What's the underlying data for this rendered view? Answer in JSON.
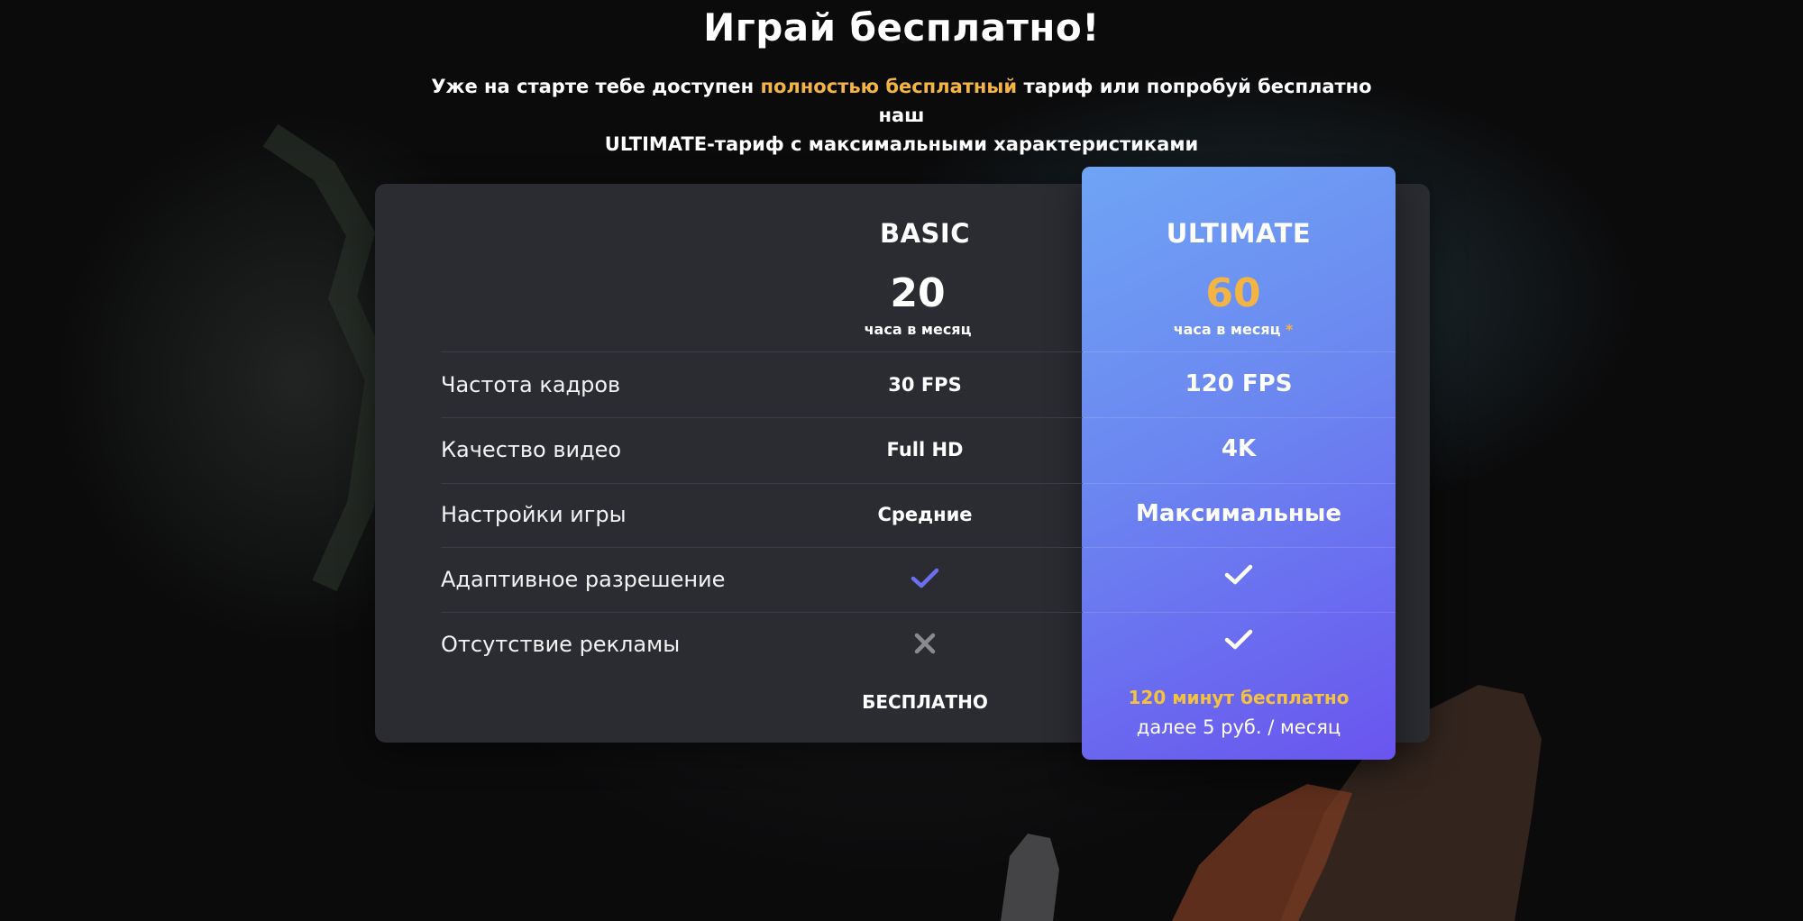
{
  "header": {
    "title": "Играй бесплатно!",
    "subtitle_part1": "Уже на старте тебе доступен ",
    "subtitle_highlight": "полностью бесплатный",
    "subtitle_part2": " тариф или попробуй бесплатно наш",
    "subtitle_line2": "ULTIMATE-тариф с максимальными характеристиками"
  },
  "plans": {
    "basic": {
      "name": "BASIC",
      "hours": "20",
      "hours_label": "часа в месяц",
      "footer": "БЕСПЛАТНО"
    },
    "ultimate": {
      "name": "ULTIMATE",
      "hours": "60",
      "hours_label": "часа в месяц",
      "hours_note_mark": "*",
      "footer_highlight": "120 минут бесплатно",
      "footer_price": "далее 5 руб. / месяц"
    }
  },
  "features": [
    {
      "label": "Частота кадров",
      "basic": "30 FPS",
      "ultimate": "120 FPS"
    },
    {
      "label": "Качество видео",
      "basic": "Full HD",
      "ultimate": "4K"
    },
    {
      "label": "Настройки игры",
      "basic": "Средние",
      "ultimate": "Максимальные"
    },
    {
      "label": "Адаптивное разрешение",
      "basic_icon": "check-icon",
      "ultimate_icon": "check-icon"
    },
    {
      "label": "Отсутствие рекламы",
      "basic_icon": "cross-icon",
      "ultimate_icon": "check-icon"
    }
  ],
  "colors": {
    "accent_orange": "#f4b443",
    "ultimate_gradient_start": "#6fa4f5",
    "ultimate_gradient_end": "#6a55ef",
    "basic_check": "#6b6ff0",
    "basic_cross": "#8a8a8e",
    "card_background": "#2b2c32"
  }
}
